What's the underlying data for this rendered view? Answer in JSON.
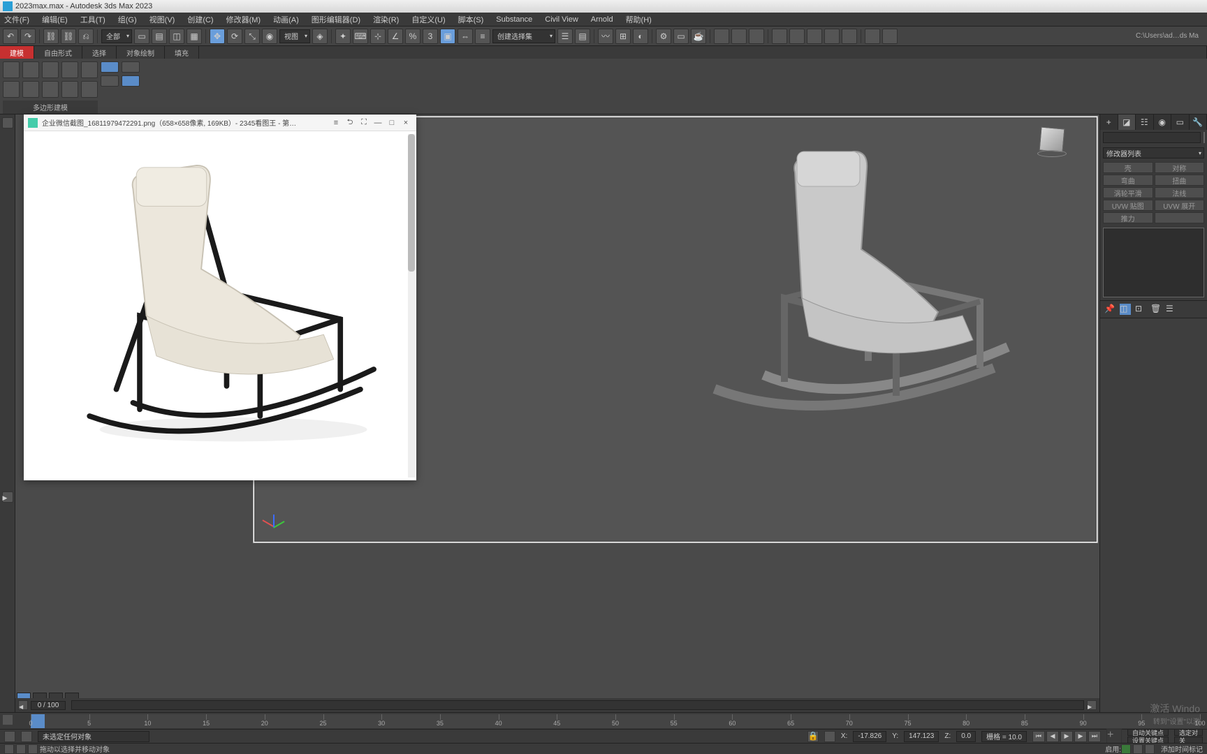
{
  "title_bar": {
    "text": "2023max.max - Autodesk 3ds Max 2023"
  },
  "menu": {
    "items": [
      "文件(F)",
      "编辑(E)",
      "工具(T)",
      "组(G)",
      "视图(V)",
      "创建(C)",
      "修改器(M)",
      "动画(A)",
      "图形编辑器(D)",
      "渲染(R)",
      "自定义(U)",
      "脚本(S)",
      "Substance",
      "Civil View",
      "Arnold",
      "帮助(H)"
    ]
  },
  "main_toolbar": {
    "selection_filter": "全部",
    "ref_coord": "视图",
    "named_sel": "创建选择集",
    "path_display": "C:\\Users\\ad…ds Ma"
  },
  "ribbon": {
    "tabs": [
      "建模",
      "自由形式",
      "选择",
      "对象绘制",
      "填充"
    ],
    "active_tab_index": 0,
    "footer_label": "多边形建模"
  },
  "image_viewer": {
    "title": "企业微信截图_16811979472291.png（658×658像素, 169KB）- 2345看图王 - 第…",
    "close": "×",
    "max": "□",
    "min": "—",
    "full": "⛶",
    "restore": "⮌",
    "more": "≡"
  },
  "cmd_panel": {
    "modifier_list_label": "修改器列表",
    "buttons": [
      "壳",
      "对称",
      "弯曲",
      "扭曲",
      "涡轮平滑",
      "法线",
      "UVW 贴图",
      "UVW 展开",
      "推力",
      ""
    ]
  },
  "time_slider": {
    "label": "0 / 100"
  },
  "timeline": {
    "ticks": [
      0,
      5,
      10,
      15,
      20,
      25,
      30,
      35,
      40,
      45,
      50,
      55,
      60,
      65,
      70,
      75,
      80,
      85,
      90,
      95,
      100
    ]
  },
  "status": {
    "prompt_left": "未选定任何对象",
    "coord_x_label": "X:",
    "coord_x": "-17.826",
    "coord_y_label": "Y:",
    "coord_y": "147.123",
    "coord_z_label": "Z:",
    "coord_z": "0.0",
    "grid_label": "栅格 = 10.0",
    "add_time_tag": "添加时间标记",
    "enable_label": "启用:",
    "auto_key": "自动关键点",
    "sel_key": "选定对",
    "set_key": "设置关键点",
    "key_filter": "关"
  },
  "prompt_bar": {
    "hint": "拖动以选择并移动对象"
  },
  "watermark": {
    "line1": "激活 Windo",
    "line2": "转到\"设置\"以激"
  }
}
